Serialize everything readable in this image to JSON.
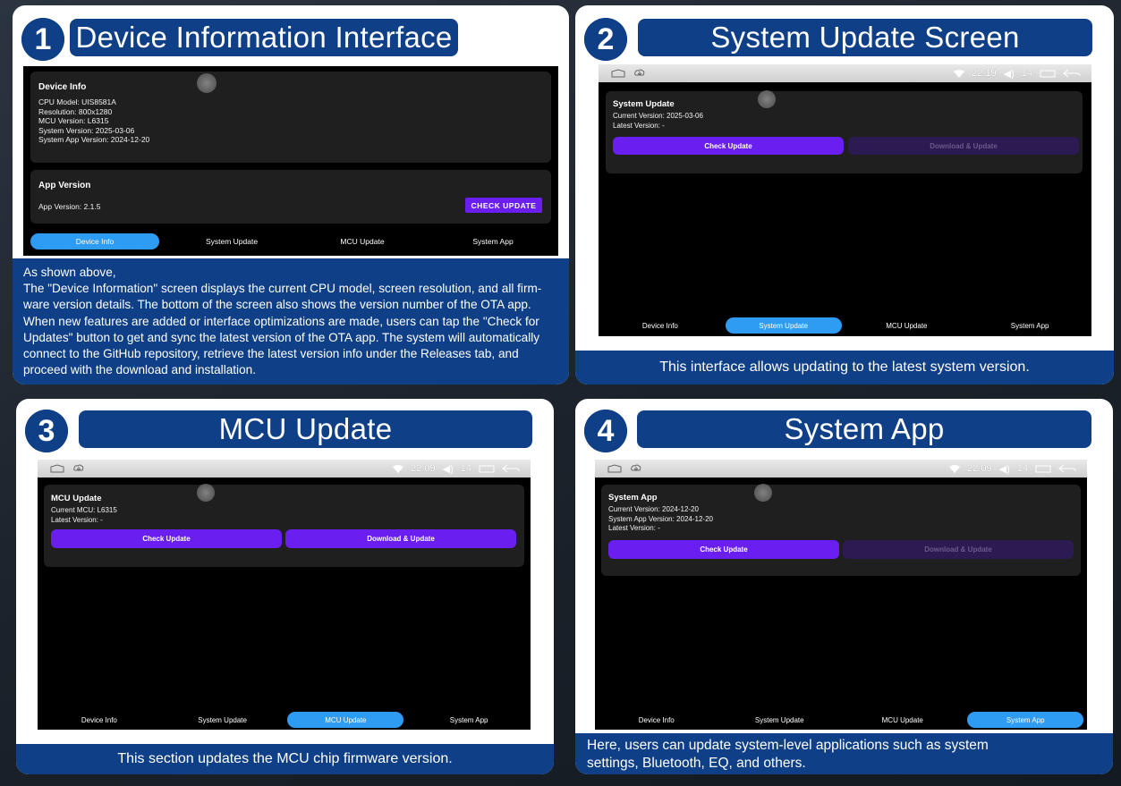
{
  "panels": [
    {
      "number": "1",
      "title": "Device Information Interface",
      "screen": {
        "info": {
          "title": "Device Info",
          "lines": [
            "CPU Model: UIS8581A",
            "Resolution: 800x1280",
            "MCU Version: L6315",
            "System Version: 2025-03-06",
            "System App Version: 2024-12-20"
          ]
        },
        "app": {
          "title": "App Version",
          "version": "App Version: 2.1.5",
          "check_button": "CHECK UPDATE"
        }
      },
      "caption_lines": [
        "As shown above,",
        "The \"Device Information\" screen displays the current CPU model, screen resolution, and all firm-",
        "ware version details. The bottom of the screen also shows the version number of the OTA app.",
        "When new features are added or interface optimizations are made, users can tap the \"Check for",
        "Updates\" button to get and sync the latest version of the OTA app. The system will automatically",
        "connect to the GitHub repository, retrieve the latest version info under the Releases tab, and",
        "proceed with the download and installation."
      ]
    },
    {
      "number": "2",
      "title": "System Update Screen",
      "status": {
        "time": "22:19",
        "volume": "14"
      },
      "screen": {
        "title": "System Update",
        "lines": [
          "Current Version: 2025-03-06",
          "Latest Version: -"
        ],
        "check_button": "Check Update",
        "download_button": "Download & Update"
      },
      "caption": "This interface allows updating to the latest system version."
    },
    {
      "number": "3",
      "title": "MCU Update",
      "status": {
        "time": "22:09",
        "volume": "14"
      },
      "screen": {
        "title": "MCU Update",
        "lines": [
          "Current MCU: L6315",
          "Latest Version: -"
        ],
        "check_button": "Check Update",
        "download_button": "Download & Update"
      },
      "caption": "This section updates the MCU chip firmware version."
    },
    {
      "number": "4",
      "title": "System App",
      "status": {
        "time": "22:09",
        "volume": "14"
      },
      "screen": {
        "title": "System App",
        "lines": [
          "Current Version: 2024-12-20",
          "System App Version: 2024-12-20",
          "Latest Version: -"
        ],
        "check_button": "Check Update",
        "download_button": "Download & Update"
      },
      "caption_lines": [
        "Here, users can update system-level applications such as system",
        "settings, Bluetooth, EQ, and others."
      ]
    }
  ],
  "nav": [
    "Device Info",
    "System Update",
    "MCU Update",
    "System App"
  ],
  "icons": {
    "home": "home-icon",
    "download": "cloud-download-icon",
    "wifi": "wifi-icon",
    "volume": "volume-icon",
    "window": "window-icon",
    "back": "back-icon"
  },
  "colors": {
    "accent_blue": "#0f3f86",
    "button_purple": "#6a1ff0",
    "nav_active": "#2f9cf4"
  }
}
